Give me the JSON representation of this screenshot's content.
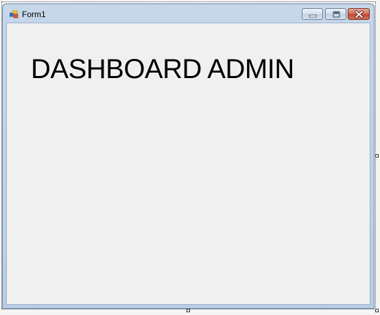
{
  "window": {
    "title": "Form1",
    "icon": "form-icon",
    "controls": {
      "minimize_icon": "minimize-icon",
      "maximize_icon": "maximize-icon",
      "close_icon": "close-icon"
    }
  },
  "form": {
    "heading": "DASHBOARD ADMIN"
  }
}
